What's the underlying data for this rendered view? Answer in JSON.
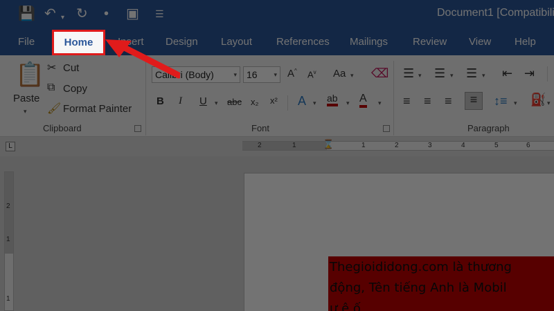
{
  "titlebar": {
    "title": "Document1 [Compatibili",
    "qat": [
      "save-icon",
      "undo-icon",
      "redo-icon",
      "dot-icon",
      "touch-mode-icon",
      "customize-icon"
    ]
  },
  "tabs": [
    {
      "label": "File"
    },
    {
      "label": "Home"
    },
    {
      "label": "Insert"
    },
    {
      "label": "Design"
    },
    {
      "label": "Layout"
    },
    {
      "label": "References"
    },
    {
      "label": "Mailings"
    },
    {
      "label": "Review"
    },
    {
      "label": "View"
    },
    {
      "label": "Help"
    }
  ],
  "clipboard": {
    "paste": "Paste",
    "cut": "Cut",
    "copy": "Copy",
    "format_painter": "Format Painter",
    "label": "Clipboard"
  },
  "font": {
    "name": "Calibri (Body)",
    "size": "16",
    "case": "Aa",
    "label": "Font",
    "bold": "B",
    "italic": "I",
    "underline": "U",
    "strike": "abc",
    "subscript": "x₂",
    "superscript": "x²"
  },
  "paragraph": {
    "label": "Paragraph"
  },
  "ruler": {
    "numbers": [
      "2",
      "1",
      "1",
      "2",
      "3",
      "4",
      "5",
      "6"
    ],
    "vnumbers": [
      "2",
      "1",
      "1"
    ]
  },
  "document": {
    "line1": "Thegioididong.com là thương",
    "line2": "động, Tên tiếng Anh là Mobil",
    "line3": "ư ệ   ố"
  },
  "colors": {
    "accent": "#2b579a",
    "highlight": "#c00000",
    "callout": "#e01b1b"
  }
}
